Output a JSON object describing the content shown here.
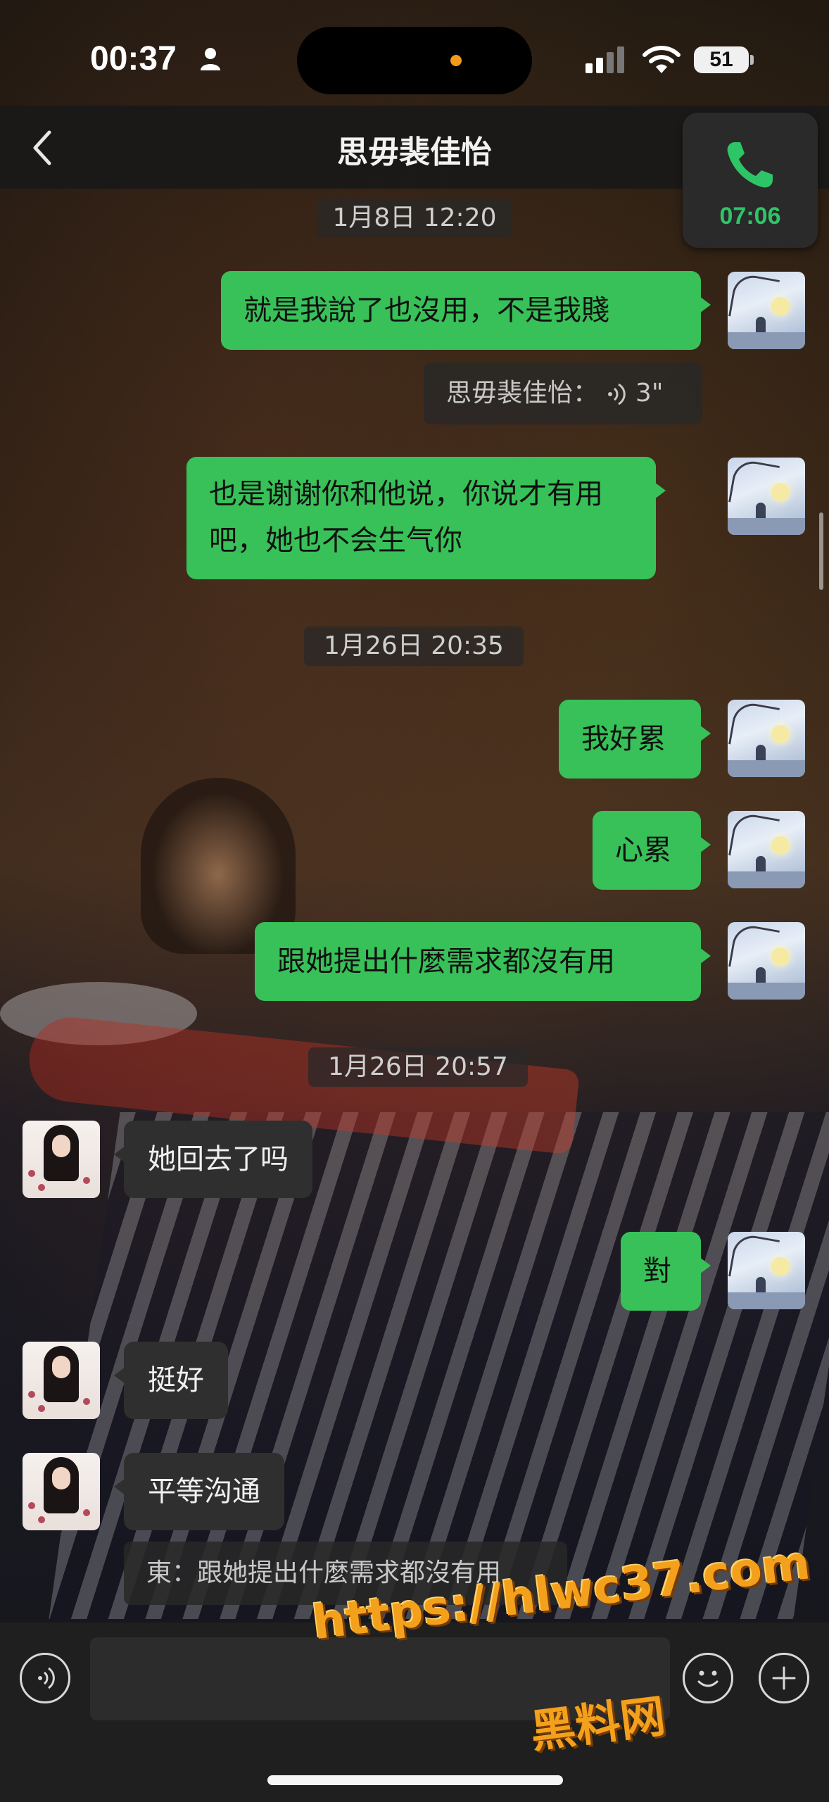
{
  "status_bar": {
    "time": "00:37",
    "battery": "51"
  },
  "header": {
    "back_label": "",
    "title": "思毋裴佳怡",
    "call_duration": "07:06"
  },
  "messages": {
    "ts1": "1月8日 12:20",
    "m1": "就是我說了也沒用，不是我賤",
    "voice_quote": "思毋裴佳怡：",
    "voice_duration": "3\"",
    "m2_line1": "也是谢谢你和他说，你说才有用",
    "m2_line2": "吧，她也不会生气你",
    "ts2": "1月26日 20:35",
    "m3": "我好累",
    "m4": "心累",
    "m5": "跟她提出什麼需求都沒有用",
    "ts3": "1月26日 20:57",
    "m6": "她回去了吗",
    "m7": "對",
    "m8": "挺好",
    "m9": "平等沟通",
    "quote": "東：跟她提出什麼需求都沒有用"
  },
  "input_bar": {
    "placeholder": ""
  },
  "watermark": {
    "url": "https://hlwc37.com",
    "site": "黑料网"
  },
  "colors": {
    "accent_green": "#37c158",
    "call_green": "#2ec567",
    "watermark_orange": "#f3a11c"
  }
}
